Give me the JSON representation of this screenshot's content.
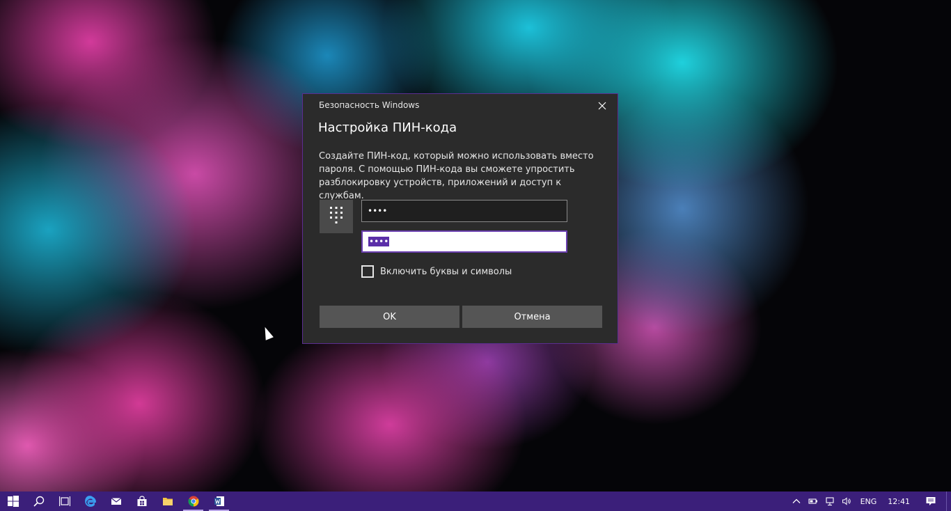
{
  "dialog": {
    "window_title": "Безопасность Windows",
    "heading": "Настройка ПИН-кода",
    "description": "Создайте ПИН-код, который можно использовать вместо пароля. С помощью ПИН-кода вы сможете упростить разблокировку устройств, приложений и доступ к службам.",
    "new_pin_value": "••••",
    "confirm_pin_value": "••••",
    "include_letters_label": "Включить буквы и символы",
    "include_letters_checked": false,
    "ok_label": "OK",
    "cancel_label": "Отмена",
    "icons": {
      "keypad": "keypad-icon",
      "close": "close-icon"
    }
  },
  "taskbar": {
    "apps": [
      {
        "icon": "windows-start-icon"
      },
      {
        "icon": "search-icon"
      },
      {
        "icon": "task-view-icon"
      },
      {
        "icon": "edge-icon"
      },
      {
        "icon": "mail-icon"
      },
      {
        "icon": "store-icon"
      },
      {
        "icon": "file-explorer-icon"
      },
      {
        "icon": "chrome-icon",
        "active": true
      },
      {
        "icon": "word-icon",
        "active": true
      }
    ],
    "tray": {
      "language": "ENG",
      "time": "12:41",
      "icons": [
        "chevron-up-icon",
        "battery-icon",
        "network-icon",
        "volume-icon",
        "notification-icon"
      ]
    }
  },
  "colors": {
    "dialog_background": "#2b2b2b",
    "accent": "#5c2d91",
    "taskbar": "#3b1f7a",
    "button": "#555555"
  }
}
